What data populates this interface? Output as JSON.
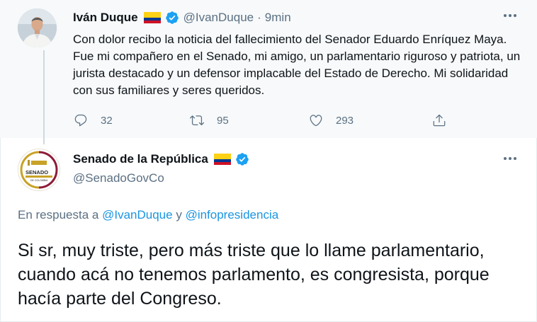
{
  "colors": {
    "link": "#1b95e0",
    "secondary_text": "#5b7083",
    "verified_blue": "#1da1f2",
    "parent_background": "#f7f9fa",
    "flag_yellow": "#fcd116",
    "flag_blue": "#003893",
    "flag_red": "#ce1126"
  },
  "parent_tweet": {
    "display_name": "Iván Duque",
    "handle": "@IvanDuque",
    "separator": "·",
    "time": "9min",
    "text": "Con dolor recibo la noticia del fallecimiento del Senador Eduardo Enríquez Maya. Fue mi compañero en el Senado, mi amigo, un parlamentario riguroso y patriota, un jurista destacado y un defensor implacable del Estado de Derecho. Mi solidaridad con sus familiares y seres queridos.",
    "actions": {
      "reply_count": "32",
      "retweet_count": "95",
      "like_count": "293"
    },
    "icons": {
      "flag": "colombia-flag-icon",
      "verified": "verified-badge-icon",
      "more": "more-options-icon",
      "reply": "reply-icon",
      "retweet": "retweet-icon",
      "like": "heart-icon",
      "share": "share-icon"
    }
  },
  "reply_tweet": {
    "display_name": "Senado de la República",
    "handle": "@SenadoGovCo",
    "avatar_logo_text": "SENADO",
    "avatar_logo_subtext": "DE COLOMBIA",
    "reply_context": {
      "prefix": "En respuesta a",
      "mention_1": "@IvanDuque",
      "joiner": "y",
      "mention_2": "@infopresidencia"
    },
    "text": "Si sr, muy triste, pero más triste que lo llame parlamentario, cuando acá no tenemos parlamento, es congresista, porque hacía parte del Congreso."
  }
}
